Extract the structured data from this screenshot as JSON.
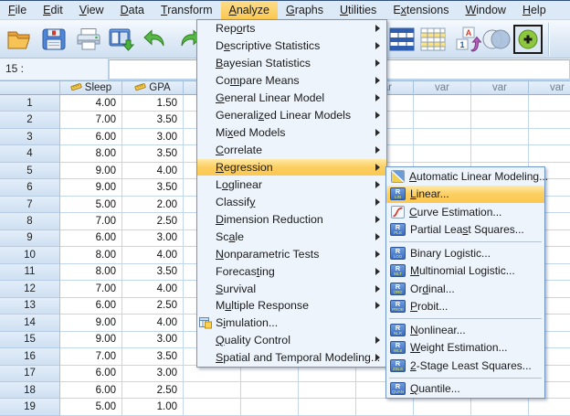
{
  "colors": {
    "selection_gold": "#FBC850",
    "menu_bg": "#EDF4FC",
    "menu_border": "#6F96C5",
    "grid_line": "#C3D7EC",
    "header_border": "#A8C3E0",
    "toolbar_edge": "#AAC4DE"
  },
  "menubar": {
    "active_item": "Analyze",
    "items": [
      {
        "label": "File",
        "accel": 0
      },
      {
        "label": "Edit",
        "accel": 0
      },
      {
        "label": "View",
        "accel": 0
      },
      {
        "label": "Data",
        "accel": 0
      },
      {
        "label": "Transform",
        "accel": 0
      },
      {
        "label": "Analyze",
        "accel": 0
      },
      {
        "label": "Graphs",
        "accel": 0
      },
      {
        "label": "Utilities",
        "accel": 0
      },
      {
        "label": "Extensions",
        "accel": 1
      },
      {
        "label": "Window",
        "accel": 0
      },
      {
        "label": "Help",
        "accel": 0
      }
    ]
  },
  "toolbar": {
    "icons": [
      "open-data",
      "save",
      "print",
      "recall-dialogs",
      "undo",
      "redo",
      "split-file",
      "variables",
      "value-labels",
      "use-sets",
      "custom-dialogs"
    ]
  },
  "cell_reference": "15 :",
  "cell_editor_value": "",
  "analyze_menu": {
    "items": [
      {
        "label": "Reports",
        "accel": 3,
        "has_submenu": true
      },
      {
        "label": "Descriptive Statistics",
        "accel": 1,
        "has_submenu": true
      },
      {
        "label": "Bayesian Statistics",
        "accel": 0,
        "has_submenu": true
      },
      {
        "label": "Compare Means",
        "accel": 2,
        "has_submenu": true
      },
      {
        "label": "General Linear Model",
        "accel": 0,
        "has_submenu": true
      },
      {
        "label": "Generalized Linear Models",
        "accel": 8,
        "has_submenu": true
      },
      {
        "label": "Mixed Models",
        "accel": 2,
        "has_submenu": true
      },
      {
        "label": "Correlate",
        "accel": 0,
        "has_submenu": true
      },
      {
        "label": "Regression",
        "accel": 0,
        "has_submenu": true,
        "highlighted": true
      },
      {
        "label": "Loglinear",
        "accel": 1,
        "has_submenu": true
      },
      {
        "label": "Classify",
        "accel": 7,
        "has_submenu": true
      },
      {
        "label": "Dimension Reduction",
        "accel": 0,
        "has_submenu": true
      },
      {
        "label": "Scale",
        "accel": 2,
        "has_submenu": true
      },
      {
        "label": "Nonparametric Tests",
        "accel": 0,
        "has_submenu": true
      },
      {
        "label": "Forecasting",
        "accel": 7,
        "has_submenu": true
      },
      {
        "label": "Survival",
        "accel": 0,
        "has_submenu": true
      },
      {
        "label": "Multiple Response",
        "accel": 1,
        "has_submenu": true
      },
      {
        "label": "Simulation...",
        "accel": 1,
        "has_submenu": false,
        "icon": "simulation"
      },
      {
        "label": "Quality Control",
        "accel": 0,
        "has_submenu": true
      },
      {
        "label": "Spatial and Temporal Modeling...",
        "accel": 0,
        "has_submenu": true
      }
    ]
  },
  "regression_submenu": {
    "items": [
      {
        "label": "Automatic Linear Modeling...",
        "accel": 0,
        "icon": {
          "type": "alm"
        }
      },
      {
        "label": "Linear...",
        "accel": 0,
        "icon": {
          "type": "r",
          "sub": "LIN"
        },
        "highlighted": true
      },
      {
        "label": "Curve Estimation...",
        "accel": 0,
        "icon": {
          "type": "curve"
        }
      },
      {
        "label": "Partial Least Squares...",
        "accel": 11,
        "icon": {
          "type": "r",
          "sub": "PLS"
        },
        "separator_after": true
      },
      {
        "label": "Binary Logistic...",
        "accel": 9,
        "icon": {
          "type": "r",
          "sub": "LOG"
        }
      },
      {
        "label": "Multinomial Logistic...",
        "accel": 0,
        "icon": {
          "type": "r",
          "sub": "MLT"
        }
      },
      {
        "label": "Ordinal...",
        "accel": 2,
        "icon": {
          "type": "r",
          "sub": "ORD"
        }
      },
      {
        "label": "Probit...",
        "accel": 0,
        "icon": {
          "type": "r",
          "sub": "PROB"
        },
        "separator_after": true
      },
      {
        "label": "Nonlinear...",
        "accel": 0,
        "icon": {
          "type": "r",
          "sub": "NLR"
        }
      },
      {
        "label": "Weight Estimation...",
        "accel": 0,
        "icon": {
          "type": "r",
          "sub": "WLS"
        }
      },
      {
        "label": "2-Stage Least Squares...",
        "accel": 0,
        "icon": {
          "type": "r",
          "sub": "2SLS"
        },
        "separator_after": true
      },
      {
        "label": "Quantile...",
        "accel": 0,
        "icon": {
          "type": "r",
          "sub": "QUAN"
        }
      }
    ]
  },
  "data_editor": {
    "columns": [
      "Sleep",
      "GPA"
    ],
    "var_placeholder": "var",
    "var_column_count": 7,
    "rows": [
      {
        "n": "1",
        "values": [
          "4.00",
          "1.50"
        ]
      },
      {
        "n": "2",
        "values": [
          "7.00",
          "3.50"
        ]
      },
      {
        "n": "3",
        "values": [
          "6.00",
          "3.00"
        ]
      },
      {
        "n": "4",
        "values": [
          "8.00",
          "3.50"
        ]
      },
      {
        "n": "5",
        "values": [
          "9.00",
          "4.00"
        ]
      },
      {
        "n": "6",
        "values": [
          "9.00",
          "3.50"
        ]
      },
      {
        "n": "7",
        "values": [
          "5.00",
          "2.00"
        ]
      },
      {
        "n": "8",
        "values": [
          "7.00",
          "2.50"
        ]
      },
      {
        "n": "9",
        "values": [
          "6.00",
          "3.00"
        ]
      },
      {
        "n": "10",
        "values": [
          "8.00",
          "4.00"
        ]
      },
      {
        "n": "11",
        "values": [
          "8.00",
          "3.50"
        ]
      },
      {
        "n": "12",
        "values": [
          "7.00",
          "4.00"
        ]
      },
      {
        "n": "13",
        "values": [
          "6.00",
          "2.50"
        ]
      },
      {
        "n": "14",
        "values": [
          "9.00",
          "4.00"
        ]
      },
      {
        "n": "15",
        "values": [
          "9.00",
          "3.00"
        ]
      },
      {
        "n": "16",
        "values": [
          "7.00",
          "3.50"
        ]
      },
      {
        "n": "17",
        "values": [
          "6.00",
          "3.00"
        ]
      },
      {
        "n": "18",
        "values": [
          "6.00",
          "2.50"
        ]
      },
      {
        "n": "19",
        "values": [
          "5.00",
          "1.00"
        ]
      }
    ]
  }
}
